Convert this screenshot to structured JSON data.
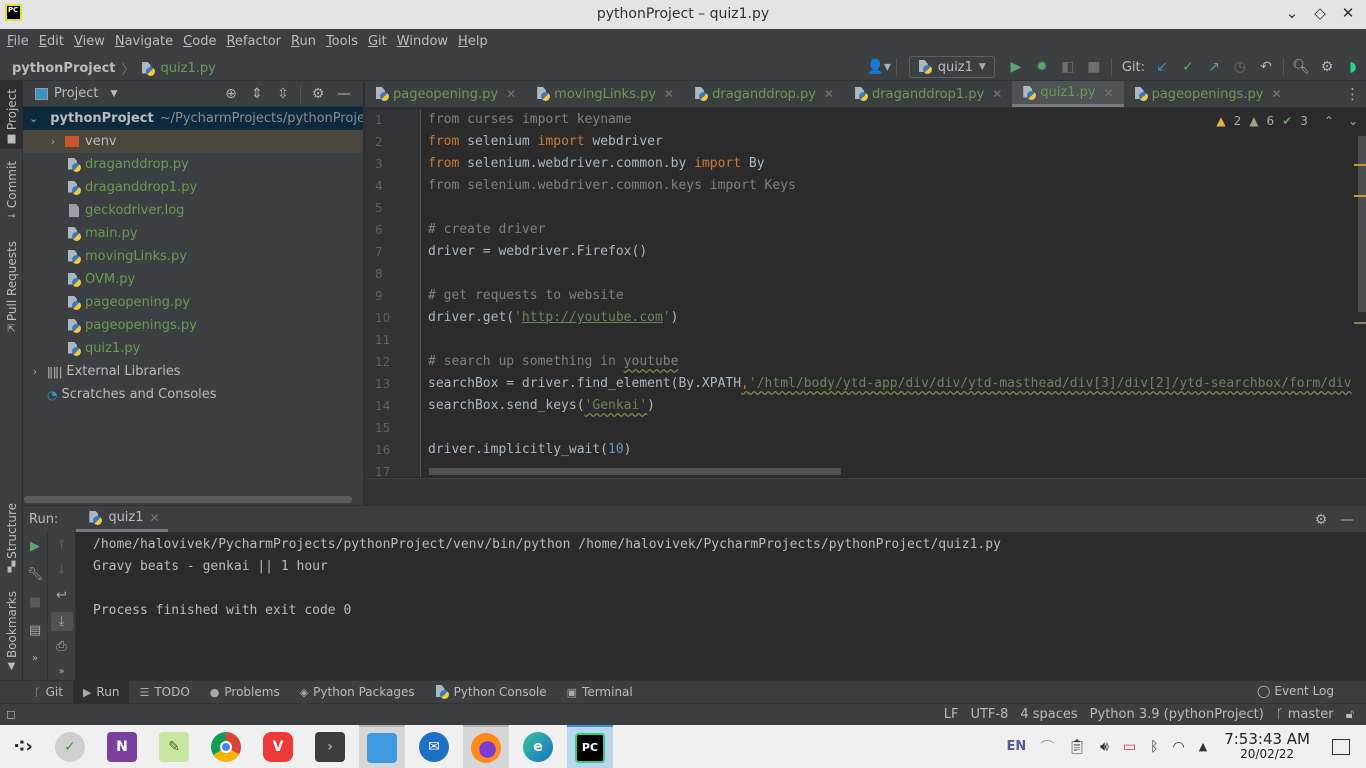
{
  "window": {
    "title": "pythonProject – quiz1.py",
    "controls": [
      "minimize",
      "maximize",
      "close"
    ]
  },
  "menu": [
    "File",
    "Edit",
    "View",
    "Navigate",
    "Code",
    "Refactor",
    "Run",
    "Tools",
    "Git",
    "Window",
    "Help"
  ],
  "breadcrumb": {
    "project": "pythonProject",
    "separator": "〉",
    "file": "quiz1.py"
  },
  "toolbar": {
    "run_config": "quiz1",
    "git_label": "Git:"
  },
  "left_strip": {
    "top": [
      "Project",
      "Commit",
      "Pull Requests"
    ],
    "bottom": [
      "Structure",
      "Bookmarks"
    ]
  },
  "project_panel": {
    "title": "Project",
    "root": {
      "name": "pythonProject",
      "path": "~/PycharmProjects/pythonProject"
    },
    "items": [
      {
        "name": "venv",
        "type": "folder"
      },
      {
        "name": "draganddrop.py",
        "type": "py"
      },
      {
        "name": "draganddrop1.py",
        "type": "py"
      },
      {
        "name": "geckodriver.log",
        "type": "log"
      },
      {
        "name": "main.py",
        "type": "py"
      },
      {
        "name": "movingLinks.py",
        "type": "py"
      },
      {
        "name": "OVM.py",
        "type": "py"
      },
      {
        "name": "pageopening.py",
        "type": "py"
      },
      {
        "name": "pageopenings.py",
        "type": "py"
      },
      {
        "name": "quiz1.py",
        "type": "py"
      }
    ],
    "external_libraries": "External Libraries",
    "scratches": "Scratches and Consoles"
  },
  "editor": {
    "tabs": [
      {
        "label": "pageopening.py",
        "active": false
      },
      {
        "label": "movingLinks.py",
        "active": false
      },
      {
        "label": "draganddrop.py",
        "active": false
      },
      {
        "label": "draganddrop1.py",
        "active": false
      },
      {
        "label": "quiz1.py",
        "active": true
      },
      {
        "label": "pageopenings.py",
        "active": false
      }
    ],
    "inspections": {
      "warnings": "2",
      "weak_warnings": "6",
      "typos": "3"
    },
    "line_numbers": [
      "1",
      "2",
      "3",
      "4",
      "5",
      "6",
      "7",
      "8",
      "9",
      "10",
      "11",
      "12",
      "13",
      "14",
      "15",
      "16",
      "17"
    ],
    "code": {
      "l1": {
        "a": "from",
        "b": " curses ",
        "c": "import",
        "d": " keyname"
      },
      "l2": {
        "a": "from",
        "b": " selenium ",
        "c": "import",
        "d": " webdriver"
      },
      "l3": {
        "a": "from",
        "b": " selenium.webdriver.common.by ",
        "c": "import",
        "d": " By"
      },
      "l4": {
        "a": "from",
        "b": " selenium.webdriver.common.keys ",
        "c": "import",
        "d": " Keys"
      },
      "l6": "# create driver",
      "l7": "driver = webdriver.Firefox()",
      "l9": "# get requests to website",
      "l10": {
        "a": "driver.get(",
        "q1": "'",
        "url": "http://youtube.com",
        "q2": "'",
        "b": ")"
      },
      "l12": {
        "a": "# search up something in ",
        "b": "youtube"
      },
      "l13": {
        "a": "searchBox = driver.find_element(By.XPATH",
        "comma": ",",
        "str": "'/html/body/ytd-app/div/div/ytd-masthead/div[3]/div[2]/ytd-searchbox/form/div"
      },
      "l14": {
        "a": "searchBox.send_keys(",
        "str": "'Genkai'",
        "b": ")"
      },
      "l16": {
        "a": "driver.implicitly_wait(",
        "num": "10",
        "b": ")"
      }
    }
  },
  "run_panel": {
    "label": "Run:",
    "tab": "quiz1",
    "output": [
      "/home/halovivek/PycharmProjects/pythonProject/venv/bin/python /home/halovivek/PycharmProjects/pythonProject/quiz1.py",
      "Gravy beats - genkai || 1 hour",
      "",
      "Process finished with exit code 0"
    ]
  },
  "tool_windows": [
    {
      "label": "Git",
      "icon": "git-branch-icon",
      "active": false
    },
    {
      "label": "Run",
      "icon": "run-icon",
      "active": true
    },
    {
      "label": "TODO",
      "icon": "list-icon",
      "active": false
    },
    {
      "label": "Problems",
      "icon": "problems-icon",
      "active": false
    },
    {
      "label": "Python Packages",
      "icon": "layers-icon",
      "active": false
    },
    {
      "label": "Python Console",
      "icon": "python-icon",
      "active": false
    },
    {
      "label": "Terminal",
      "icon": "terminal-icon",
      "active": false
    }
  ],
  "event_log": "Event Log",
  "status": {
    "line_sep": "LF",
    "encoding": "UTF-8",
    "indent": "4 spaces",
    "interpreter": "Python 3.9 (pythonProject)",
    "branch": "master"
  },
  "taskbar": {
    "apps": [
      {
        "name": "app-launcher",
        "state": "idle"
      },
      {
        "name": "clock-app",
        "state": "idle"
      },
      {
        "name": "onenote",
        "state": "idle"
      },
      {
        "name": "text-editor",
        "state": "idle"
      },
      {
        "name": "chrome",
        "state": "idle"
      },
      {
        "name": "vivaldi",
        "state": "idle"
      },
      {
        "name": "terminal",
        "state": "idle"
      },
      {
        "name": "file-manager",
        "state": "open"
      },
      {
        "name": "thunderbird",
        "state": "idle"
      },
      {
        "name": "firefox",
        "state": "open"
      },
      {
        "name": "edge",
        "state": "idle"
      },
      {
        "name": "pycharm",
        "state": "focused"
      }
    ],
    "language": "EN",
    "time": "7:53:43 AM",
    "date": "20/02/22"
  },
  "colors": {
    "keyword": "#cc7832",
    "string": "#6a8759",
    "number": "#6897bb",
    "comment": "#808080",
    "file_green": "#6a9a53",
    "warning": "#e3b341"
  }
}
